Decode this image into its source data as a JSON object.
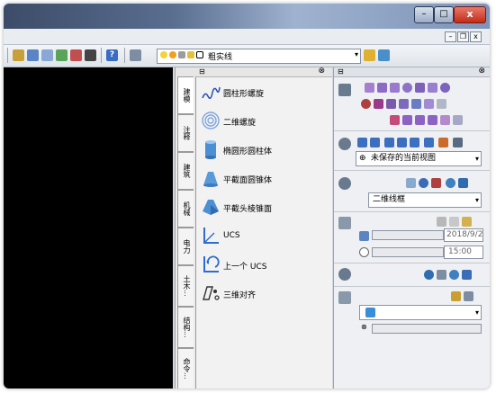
{
  "titlebar": {
    "minimize_label": "–",
    "maximize_label": "□",
    "close_label": "x"
  },
  "menubar": {
    "mdi_minimize": "–",
    "mdi_restore": "❐",
    "mdi_close": "x"
  },
  "layer_control": {
    "value": "粗实线",
    "arrow": "▾"
  },
  "tool_palette": {
    "tabs": [
      "建模",
      "注释",
      "建筑",
      "机械",
      "电力",
      "土木...",
      "结构...",
      "命令..."
    ],
    "tools": [
      {
        "label": "圆柱形螺旋",
        "icon": "helix-icon"
      },
      {
        "label": "二维螺旋",
        "icon": "spiral-icon"
      },
      {
        "label": "椭圆形圆柱体",
        "icon": "elliptical-cylinder-icon"
      },
      {
        "label": "平截面圆锥体",
        "icon": "frustum-cone-icon"
      },
      {
        "label": "平截头棱锥面",
        "icon": "frustum-pyramid-icon"
      },
      {
        "label": "UCS",
        "icon": "ucs-icon"
      },
      {
        "label": "上一个 UCS",
        "icon": "ucs-previous-icon"
      },
      {
        "label": "三维对齐",
        "icon": "3d-align-icon"
      }
    ]
  },
  "dashboard": {
    "view_select": {
      "value": "未保存的当前视图",
      "arrow": "▾"
    },
    "visual_style_select": {
      "value": "二维线框",
      "arrow": "▾"
    },
    "date_value": "2018/9/2",
    "time_value": "15:00",
    "material_select": {
      "value": "",
      "arrow": "▾"
    }
  },
  "colors": {
    "titlebar": "#4a5c7c",
    "canvas": "#000000",
    "close": "#c8321e"
  }
}
